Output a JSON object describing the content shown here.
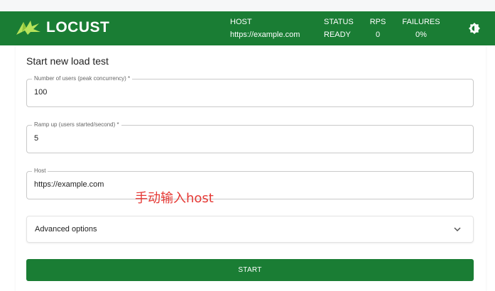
{
  "navbar": {
    "logo_text": "LOCUST",
    "host": {
      "label": "HOST",
      "value": "https://example.com"
    },
    "status": {
      "label": "STATUS",
      "value": "READY"
    },
    "rps": {
      "label": "RPS",
      "value": "0"
    },
    "failures": {
      "label": "FAILURES",
      "value": "0%"
    },
    "theme_icon": "brightness-icon"
  },
  "form": {
    "title": "Start new load test",
    "users": {
      "label": "Number of users (peak concurrency) *",
      "value": "100"
    },
    "ramp_up": {
      "label": "Ramp up (users started/second) *",
      "value": "5"
    },
    "host": {
      "label": "Host",
      "value": "https://example.com"
    },
    "advanced_label": "Advanced options",
    "start_label": "START"
  },
  "annotation": "手动输入host",
  "colors": {
    "brand": "#1a7d34",
    "annotation": "#e53935"
  }
}
